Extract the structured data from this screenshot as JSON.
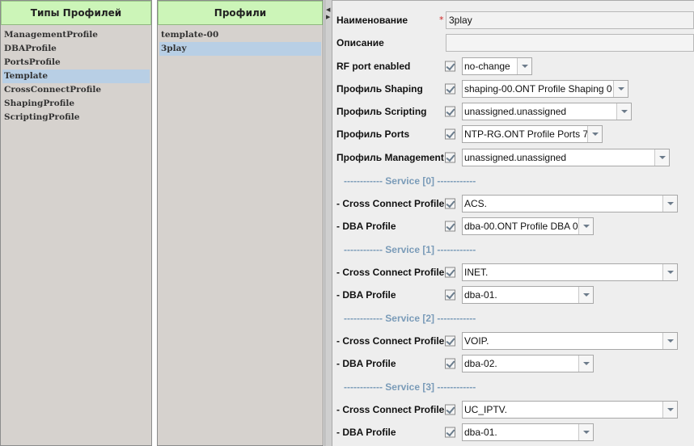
{
  "panels": {
    "types": {
      "title": "Типы Профилей",
      "items": [
        "ManagementProfile",
        "DBAProfile",
        "PortsProfile",
        "Template",
        "CrossConnectProfile",
        "ShapingProfile",
        "ScriptingProfile"
      ],
      "selected": "Template"
    },
    "profiles": {
      "title": "Профили",
      "items": [
        "template-00",
        "3play"
      ],
      "selected": "3play"
    }
  },
  "form": {
    "name_label": "Наименование",
    "name_required": "*",
    "name_value": "3play",
    "description_label": "Описание",
    "description_value": "",
    "rf_label": "RF port enabled",
    "rf_value": "no-change",
    "shaping_label": "Профиль Shaping",
    "shaping_value": "shaping-00.ONT Profile Shaping 0",
    "scripting_label": "Профиль Scripting",
    "scripting_value": "unassigned.unassigned",
    "ports_label": "Профиль Ports",
    "ports_value": "NTP-RG.ONT Profile Ports 7",
    "management_label": "Профиль Management",
    "management_value": "unassigned.unassigned",
    "services": [
      {
        "header": "------------ Service [0] ------------",
        "cc_label": "- Cross Connect Profile",
        "cc_value": "ACS.",
        "dba_label": "- DBA Profile",
        "dba_value": "dba-00.ONT Profile DBA 0"
      },
      {
        "header": "------------ Service [1] ------------",
        "cc_label": "- Cross Connect Profile",
        "cc_value": "INET.",
        "dba_label": "- DBA Profile",
        "dba_value": "dba-01."
      },
      {
        "header": "------------ Service [2] ------------",
        "cc_label": "- Cross Connect Profile",
        "cc_value": "VOIP.",
        "dba_label": "- DBA Profile",
        "dba_value": "dba-02."
      },
      {
        "header": "------------ Service [3] ------------",
        "cc_label": "- Cross Connect Profile",
        "cc_value": "UC_IPTV.",
        "dba_label": "- DBA Profile",
        "dba_value": "dba-01."
      }
    ]
  },
  "colors": {
    "header_bg": "#ccf5b8",
    "selection": "#b8cfe5",
    "section_label": "#7a9bb8",
    "required": "#cc2222"
  }
}
